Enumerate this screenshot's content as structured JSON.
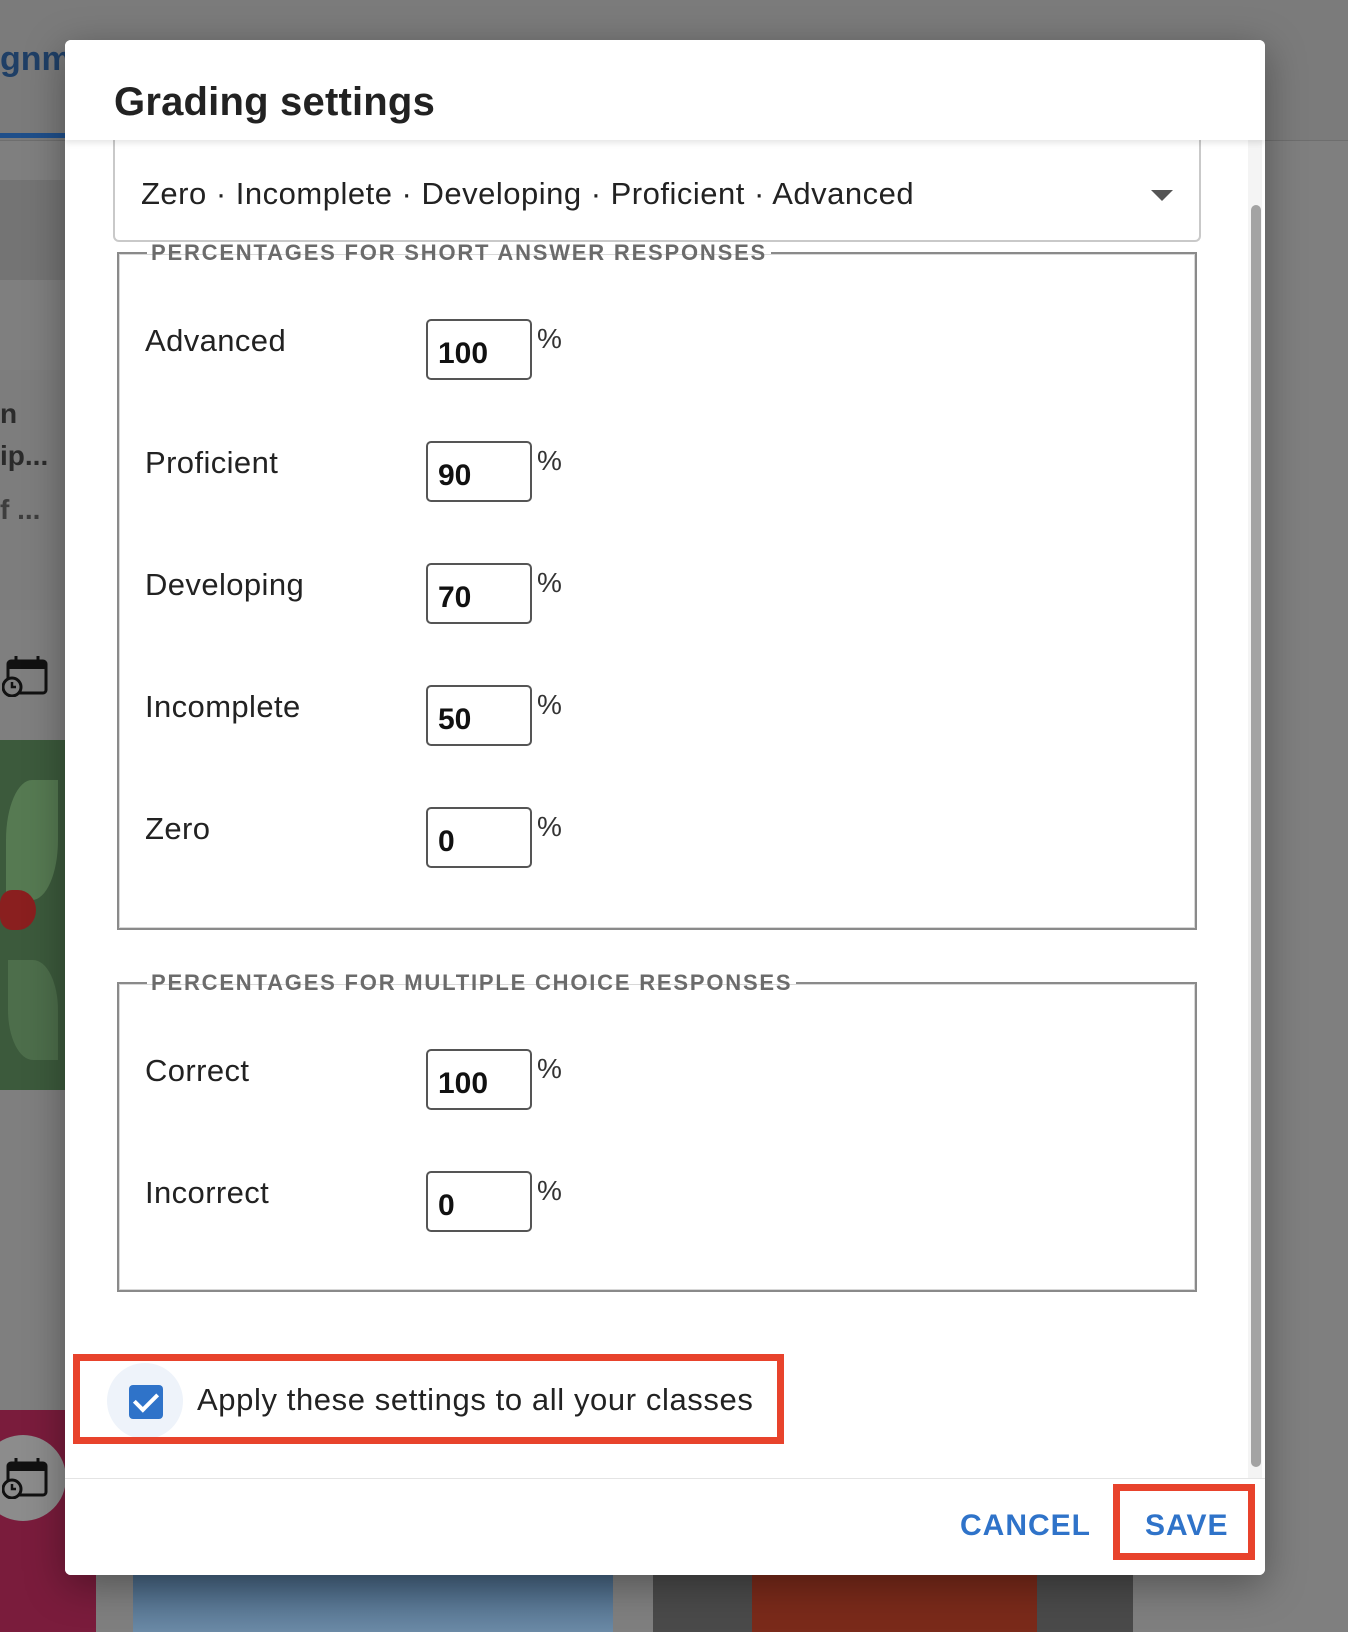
{
  "background": {
    "tab_fragment": "gnm",
    "card_lines": [
      "n",
      "ip...",
      "f ..."
    ]
  },
  "dialog": {
    "title": "Grading settings",
    "scale_value": "Zero · Incomplete · Developing · Proficient · Advanced",
    "short_answer": {
      "legend": "PERCENTAGES FOR SHORT ANSWER RESPONSES",
      "rows": [
        {
          "label": "Advanced",
          "value": "100"
        },
        {
          "label": "Proficient",
          "value": "90"
        },
        {
          "label": "Developing",
          "value": "70"
        },
        {
          "label": "Incomplete",
          "value": "50"
        },
        {
          "label": "Zero",
          "value": "0"
        }
      ]
    },
    "multiple_choice": {
      "legend": "PERCENTAGES FOR MULTIPLE CHOICE RESPONSES",
      "rows": [
        {
          "label": "Correct",
          "value": "100"
        },
        {
          "label": "Incorrect",
          "value": "0"
        }
      ]
    },
    "unit": "%",
    "apply_all": {
      "label": "Apply these settings to all your classes",
      "checked": true
    },
    "footer": {
      "cancel": "CANCEL",
      "save": "SAVE"
    }
  },
  "colors": {
    "accent": "#2f73c9",
    "highlight": "#e8432c"
  }
}
